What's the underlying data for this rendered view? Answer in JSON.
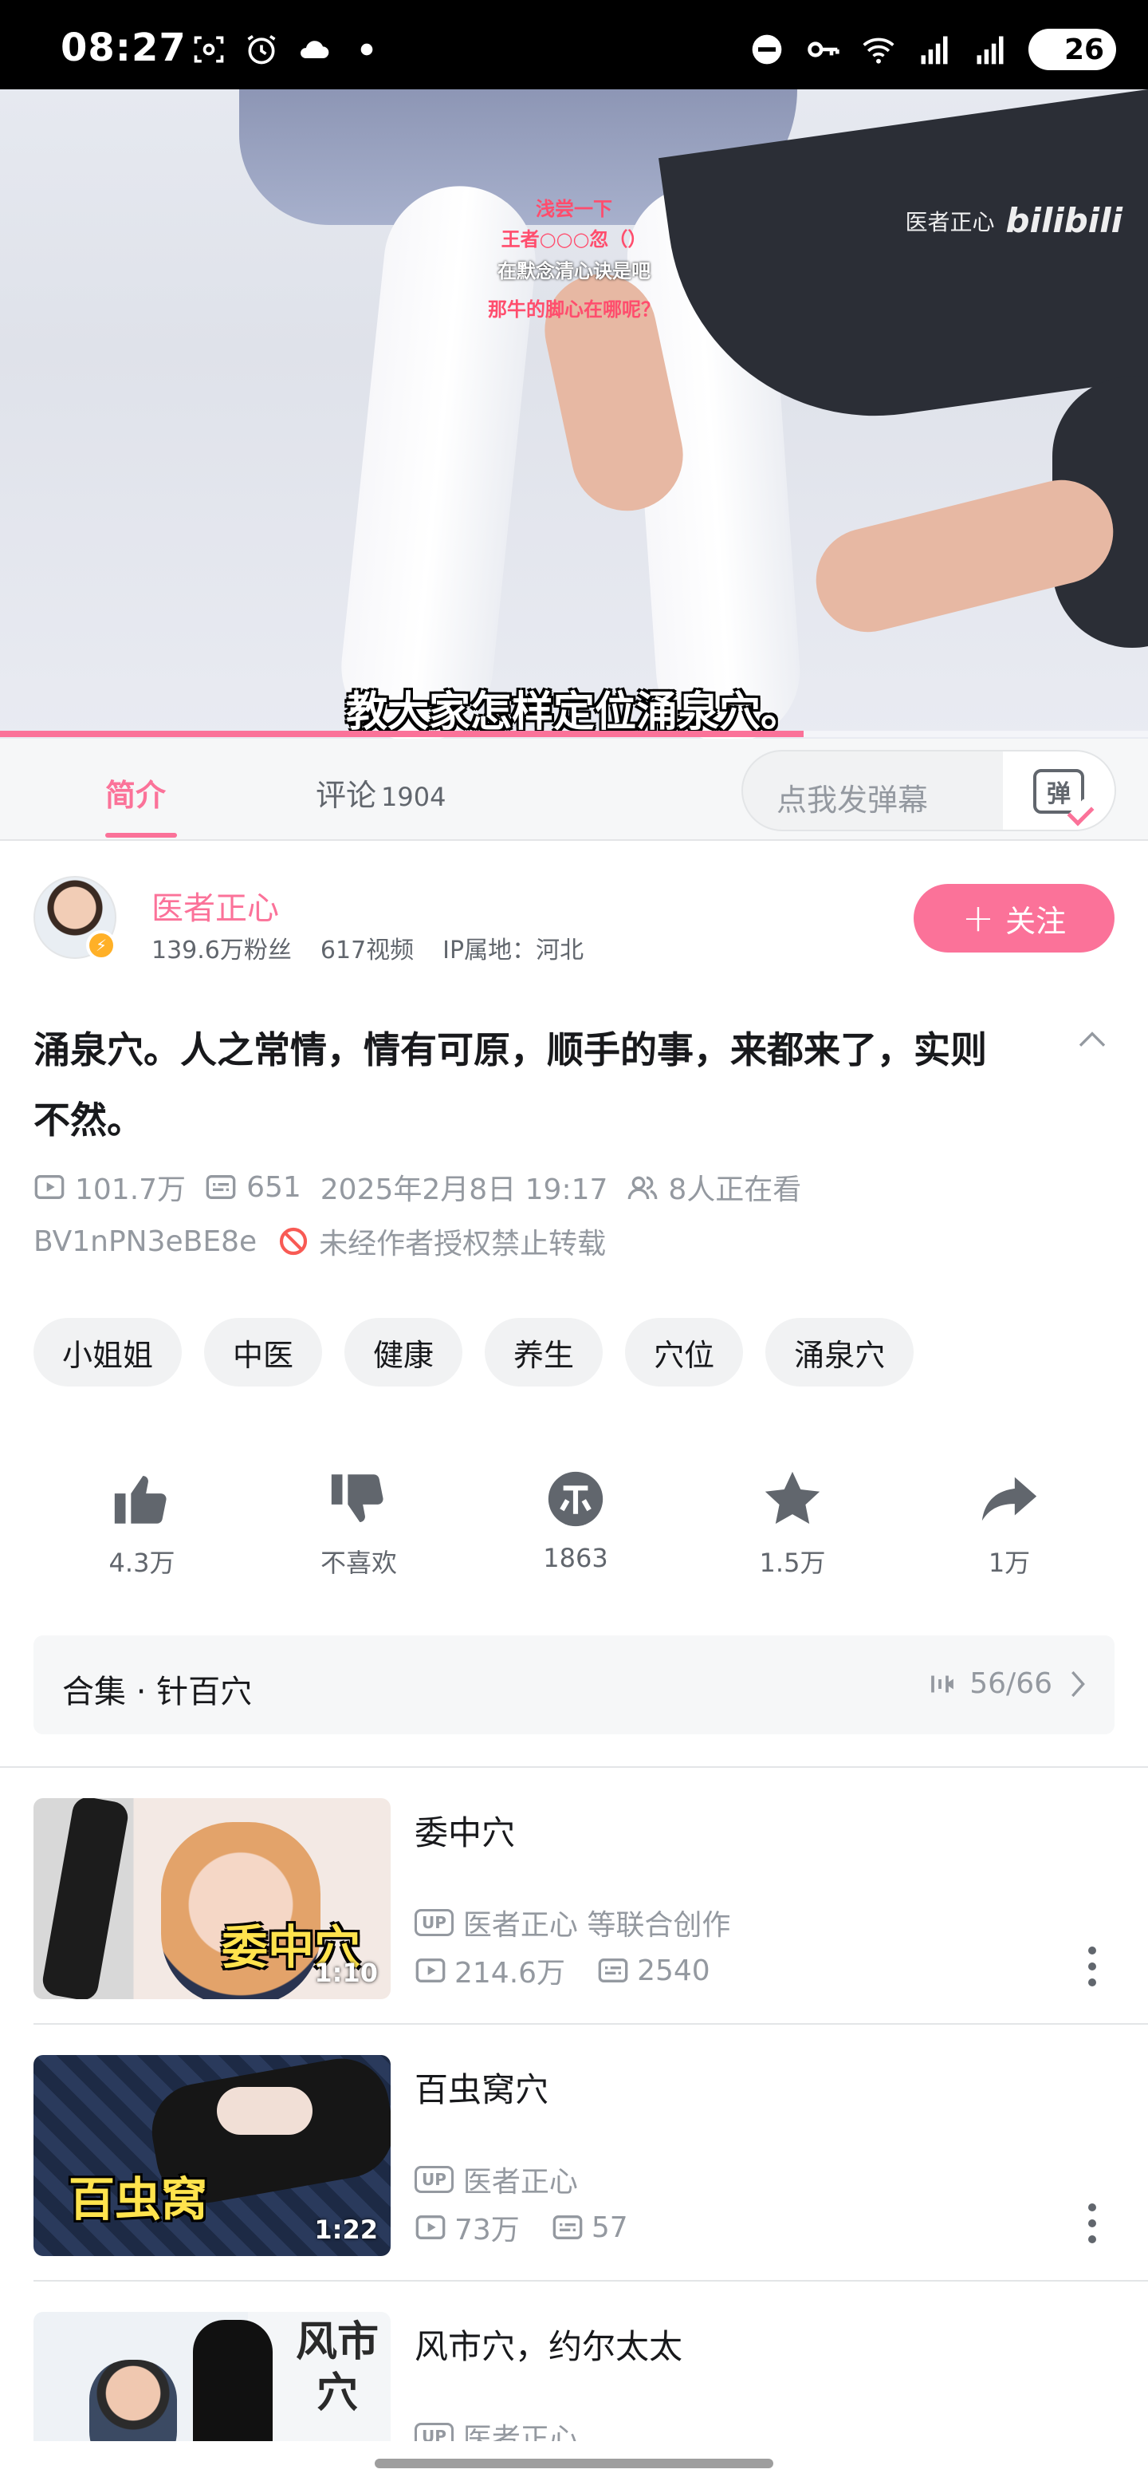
{
  "status_bar": {
    "time": "08:27",
    "battery": "26"
  },
  "video": {
    "danmaku": [
      "浅尝一下",
      "王者○○○忽（）",
      "在默念清心诀是吧",
      "那牛的脚心在哪呢？"
    ],
    "watermark": "医者正心",
    "watermark_logo": "bilibili",
    "subtitle": "教大家怎样定位涌泉穴。",
    "progress": 0.7
  },
  "tabs": {
    "intro": "简介",
    "comments": "评论",
    "comments_count": "1904",
    "danmaku_placeholder": "点我发弹幕",
    "danmaku_button": "弹"
  },
  "uploader": {
    "name": "医者正心",
    "fans": "139.6万粉丝",
    "videos": "617视频",
    "ip": "IP属地：河北",
    "follow": "关注"
  },
  "video_info": {
    "title": "涌泉穴。人之常情，情有可原，顺手的事，来都来了，实则不然。",
    "views": "101.7万",
    "danmaku_count": "651",
    "date": "2025年2月8日 19:17",
    "watching": "8人正在看",
    "bvid": "BV1nPN3eBE8e",
    "copyright": "未经作者授权禁止转载"
  },
  "tags": [
    "小姐姐",
    "中医",
    "健康",
    "养生",
    "穴位",
    "涌泉穴"
  ],
  "actions": {
    "like": "4.3万",
    "dislike": "不喜欢",
    "coin": "1863",
    "favorite": "1.5万",
    "share": "1万"
  },
  "collection": {
    "title": "合集 · 针百穴",
    "progress": "56/66"
  },
  "related": [
    {
      "title": "委中穴",
      "thumb_text": "委中穴",
      "duration": "1:10",
      "up": "医者正心 等联合创作",
      "views": "214.6万",
      "danmaku": "2540"
    },
    {
      "title": "百虫窝穴",
      "thumb_text": "百虫窝",
      "duration": "1:22",
      "up": "医者正心",
      "views": "73万",
      "danmaku": "57"
    },
    {
      "title": "风市穴，约尔太太",
      "thumb_text": "风市穴",
      "duration": "",
      "up": "医者正心",
      "views": "",
      "danmaku": ""
    }
  ],
  "colors": {
    "accent": "#fb7299",
    "text": "#18191c",
    "secondary": "#9499a0",
    "warning": "#f85a54"
  }
}
